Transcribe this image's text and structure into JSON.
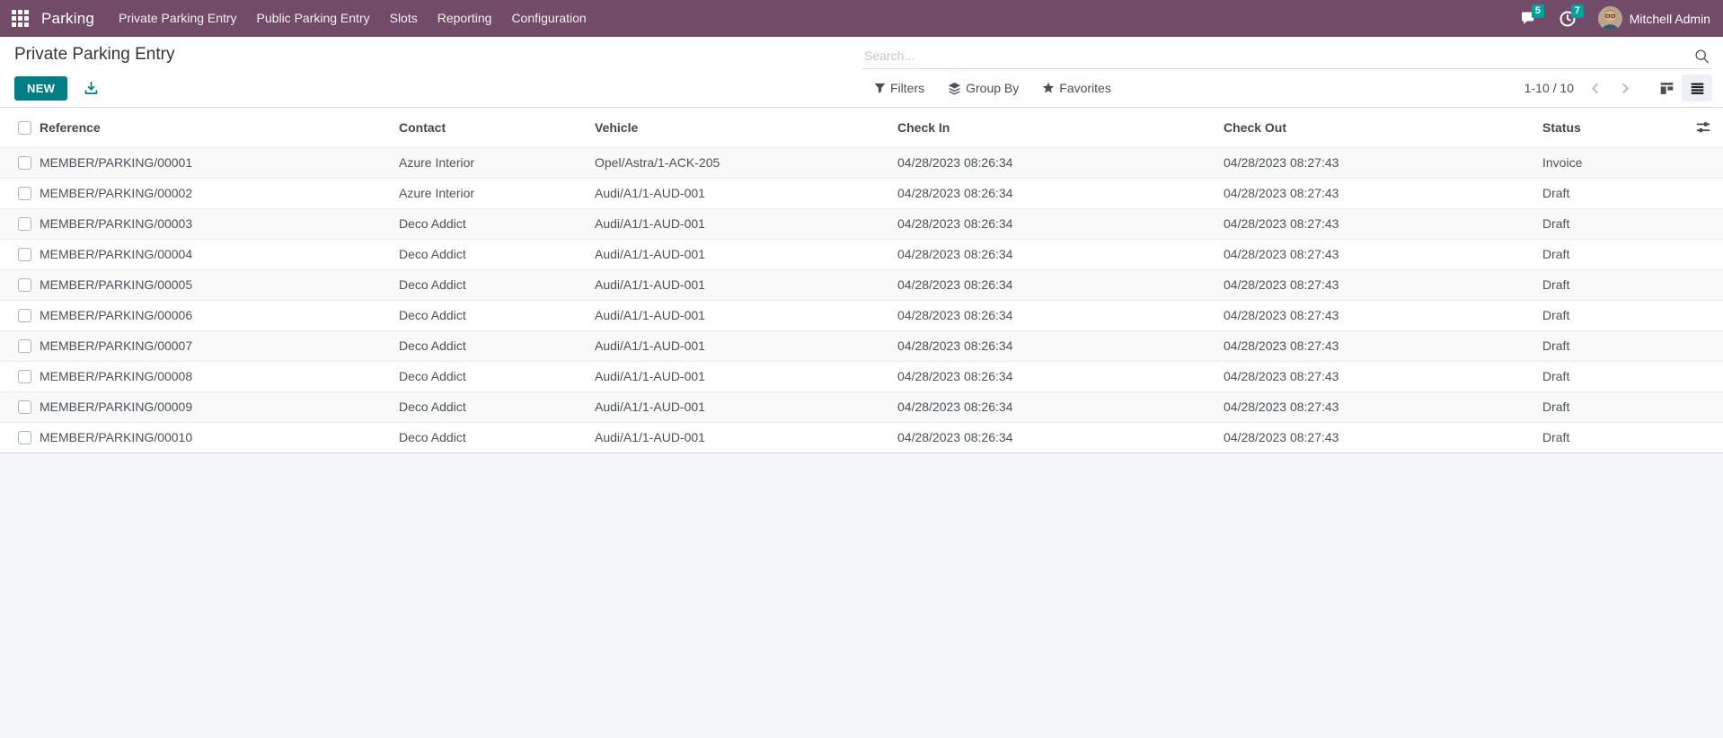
{
  "navbar": {
    "app_name": "Parking",
    "menu_items": [
      "Private Parking Entry",
      "Public Parking Entry",
      "Slots",
      "Reporting",
      "Configuration"
    ],
    "messages_badge": "5",
    "activities_badge": "7",
    "user_name": "Mitchell Admin"
  },
  "control_panel": {
    "title": "Private Parking Entry",
    "new_button_label": "NEW",
    "search_placeholder": "Search...",
    "filters_label": "Filters",
    "group_by_label": "Group By",
    "favorites_label": "Favorites",
    "pager_text": "1-10 / 10"
  },
  "table": {
    "columns": [
      "Reference",
      "Contact",
      "Vehicle",
      "Check In",
      "Check Out",
      "Status"
    ],
    "rows": [
      {
        "reference": "MEMBER/PARKING/00001",
        "contact": "Azure Interior",
        "vehicle": "Opel/Astra/1-ACK-205",
        "check_in": "04/28/2023 08:26:34",
        "check_out": "04/28/2023 08:27:43",
        "status": "Invoice"
      },
      {
        "reference": "MEMBER/PARKING/00002",
        "contact": "Azure Interior",
        "vehicle": "Audi/A1/1-AUD-001",
        "check_in": "04/28/2023 08:26:34",
        "check_out": "04/28/2023 08:27:43",
        "status": "Draft"
      },
      {
        "reference": "MEMBER/PARKING/00003",
        "contact": "Deco Addict",
        "vehicle": "Audi/A1/1-AUD-001",
        "check_in": "04/28/2023 08:26:34",
        "check_out": "04/28/2023 08:27:43",
        "status": "Draft"
      },
      {
        "reference": "MEMBER/PARKING/00004",
        "contact": "Deco Addict",
        "vehicle": "Audi/A1/1-AUD-001",
        "check_in": "04/28/2023 08:26:34",
        "check_out": "04/28/2023 08:27:43",
        "status": "Draft"
      },
      {
        "reference": "MEMBER/PARKING/00005",
        "contact": "Deco Addict",
        "vehicle": "Audi/A1/1-AUD-001",
        "check_in": "04/28/2023 08:26:34",
        "check_out": "04/28/2023 08:27:43",
        "status": "Draft"
      },
      {
        "reference": "MEMBER/PARKING/00006",
        "contact": "Deco Addict",
        "vehicle": "Audi/A1/1-AUD-001",
        "check_in": "04/28/2023 08:26:34",
        "check_out": "04/28/2023 08:27:43",
        "status": "Draft"
      },
      {
        "reference": "MEMBER/PARKING/00007",
        "contact": "Deco Addict",
        "vehicle": "Audi/A1/1-AUD-001",
        "check_in": "04/28/2023 08:26:34",
        "check_out": "04/28/2023 08:27:43",
        "status": "Draft"
      },
      {
        "reference": "MEMBER/PARKING/00008",
        "contact": "Deco Addict",
        "vehicle": "Audi/A1/1-AUD-001",
        "check_in": "04/28/2023 08:26:34",
        "check_out": "04/28/2023 08:27:43",
        "status": "Draft"
      },
      {
        "reference": "MEMBER/PARKING/00009",
        "contact": "Deco Addict",
        "vehicle": "Audi/A1/1-AUD-001",
        "check_in": "04/28/2023 08:26:34",
        "check_out": "04/28/2023 08:27:43",
        "status": "Draft"
      },
      {
        "reference": "MEMBER/PARKING/00010",
        "contact": "Deco Addict",
        "vehicle": "Audi/A1/1-AUD-001",
        "check_in": "04/28/2023 08:26:34",
        "check_out": "04/28/2023 08:27:43",
        "status": "Draft"
      }
    ]
  },
  "colors": {
    "navbar_bg": "#714B67",
    "accent_teal": "#017E84",
    "badge_teal": "#00A09D"
  }
}
